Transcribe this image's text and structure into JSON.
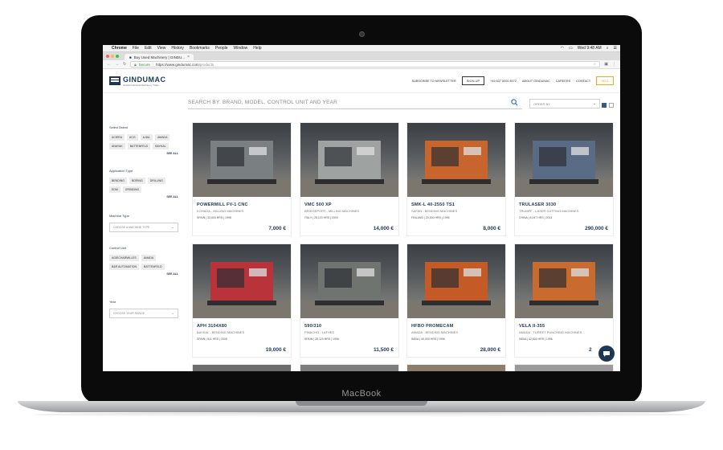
{
  "menubar": {
    "app": "Chrome",
    "items": [
      "File",
      "Edit",
      "View",
      "History",
      "Bookmarks",
      "People",
      "Window",
      "Help"
    ],
    "clock": "Wed 9:48 AM"
  },
  "browser": {
    "tab_title": "Buy Used Machinery | GINDU...",
    "secure_label": "Secure",
    "url_host": "https://www.gindumac.com",
    "url_path": "/products"
  },
  "header": {
    "logo": "GINDUMAC",
    "tagline": "Global Industrial Machinery Trade",
    "newsletter": "SUBSCRIBE TO NEWSLETTER",
    "signup": "SIGN UP",
    "phone": "+49 637 5000 8072",
    "about": "ABOUT GINDUMAC",
    "careers": "CAREERS",
    "contact": "CONTACT",
    "sell": "SELL"
  },
  "search": {
    "placeholder": "SEARCH BY: BRAND, MODEL, CONTROL UNIT AND YEAR",
    "order_by": "ORDER BY"
  },
  "filters": {
    "brand": {
      "title": "Select Brand",
      "chips": [
        "ACIERA",
        "ACG",
        "AJIAL",
        "AMADA",
        "ANAYAK",
        "BATTENFELD",
        "BAYKAL"
      ],
      "see_all": "SEE ALL"
    },
    "application": {
      "title": "Application Type",
      "chips": [
        "BENDING",
        "BORING",
        "DRILLING",
        "EDM",
        "GRINDING"
      ],
      "see_all": "SEE ALL"
    },
    "machine": {
      "title": "Machine Type",
      "select": "CHOOSE A MACHINE TYPE"
    },
    "control": {
      "title": "Control Unit",
      "chips": [
        "AGIECHARMILLES",
        "AMADA",
        "B&R AUTOMATION",
        "BATTENFELD"
      ],
      "see_all": "SEE ALL"
    },
    "year": {
      "title": "Year",
      "select": "CHOOSE YEAR RANGE"
    }
  },
  "products": [
    {
      "title": "POWERMILL FV-1 CNC",
      "sub": "KOHADA - MILLING MACHINES",
      "meta": "SPAIN  |  33,600 HRS  |  1998",
      "price": "7,000 €",
      "color": "#7a7f82"
    },
    {
      "title": "VMC 500 XP",
      "sub": "BRIDGEPORT - MILLING MACHINES",
      "meta": "ITALY  |  28,120 HRS  |  2003",
      "price": "14,000 €",
      "color": "#9ea3a1"
    },
    {
      "title": "SMK-L 40-2550 TS1",
      "sub": "SAFAN - BENDING MACHINES",
      "meta": "FINLAND  |  20,000 HRS  |  1996",
      "price": "8,000 €",
      "color": "#c8652c"
    },
    {
      "title": "TRULASER 3030",
      "sub": "TRUMPF - LASER CUTTING MACHINES",
      "meta": "CHINA  |  8,047 HRS  |  2014",
      "price": "290,000 €",
      "color": "#5a6b86"
    },
    {
      "title": "APH 3104X80",
      "sub": "BAYKAL - BENDING MACHINES",
      "meta": "SPAIN  |  811 HRS  |  2005",
      "price": "19,000 €",
      "color": "#b8343a"
    },
    {
      "title": "590/310",
      "sub": "PINACHO - LATHES",
      "meta": "SPAIN  |  28,120 HRS  |  1996",
      "price": "11,500 €",
      "color": "#6f7470"
    },
    {
      "title": "HFBO PROMECAM",
      "sub": "AMADA - BENDING MACHINES",
      "meta": "INDIA  |  40,000 HRS  |  1996",
      "price": "28,000 €",
      "color": "#c45b26"
    },
    {
      "title": "VELA II-355",
      "sub": "AMADA - TURRET PUNCHING MACHINES",
      "meta": "INDIA  |  42,600 HRS  |  1996",
      "price": "2",
      "color": "#c96a2e"
    }
  ],
  "laptop": {
    "brand": "MacBook"
  }
}
